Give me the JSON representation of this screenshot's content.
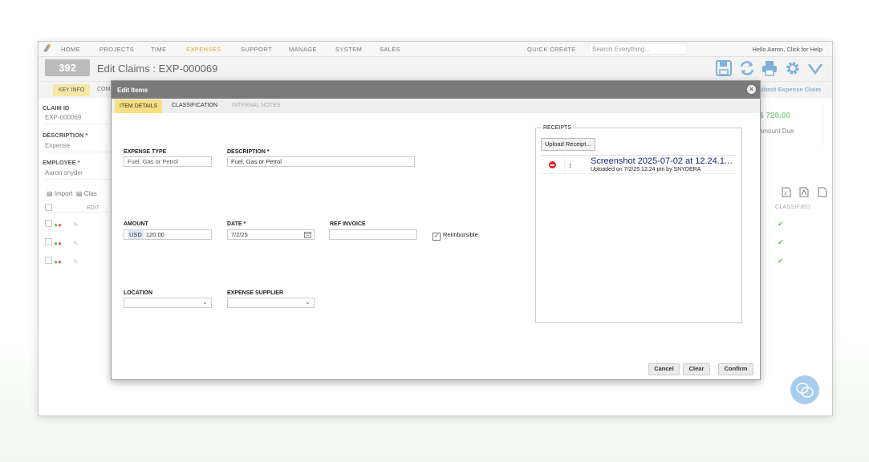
{
  "nav": {
    "items": [
      "HOME",
      "PROJECTS",
      "TIME",
      "EXPENSES",
      "SUPPORT",
      "MANAGE",
      "SYSTEM",
      "SALES"
    ],
    "active": "EXPENSES",
    "quick_create": "QUICK CREATE",
    "search_placeholder": "Search Everything...",
    "hello": "Hello Aaron, Click for Help"
  },
  "header": {
    "badge": "392",
    "title": "Edit Claims : EXP-000069",
    "submit": "Submit Expense Claim"
  },
  "subtabs": {
    "key_info": "KEY INFO",
    "comm": "COMM"
  },
  "claim": {
    "claim_id_label": "CLAIM ID",
    "claim_id": "EXP-000069",
    "description_label": "DESCRIPTION *",
    "description": "Expense",
    "employee_label": "EMPLOYEE *",
    "employee": "Aaron snyder"
  },
  "grid": {
    "import": "Import",
    "class": "Clas",
    "edit_header": "EDIT",
    "classified_header": "CLASSIFIED"
  },
  "summary": {
    "amount": "$ 720.00",
    "amount_label": "Amount Due"
  },
  "modal": {
    "title": "Edit Items",
    "tabs": [
      "ITEM DETAILS",
      "CLASSIFICATION",
      "INTERNAL NOTES"
    ],
    "expense_type_label": "EXPENSE TYPE",
    "expense_type": "Fuel, Gas or Petrol",
    "description_label": "DESCRIPTION *",
    "description": "Fuel, Gas or Petrol",
    "amount_label": "AMOUNT",
    "currency": "USD",
    "amount": "120.00",
    "date_label": "DATE *",
    "date": "7/2/25",
    "ref_invoice_label": "REF INVOICE",
    "ref_invoice": "",
    "reimbursible_label": "Reimbursible",
    "reimbursible_checked": true,
    "location_label": "LOCATION",
    "supplier_label": "EXPENSE SUPPLIER",
    "receipts_label": "RECEIPTS",
    "upload_label": "Upload Receipt...",
    "receipt_name": "Screenshot 2025-07-02 at 12.24.11 pm",
    "receipt_info": "Uploaded on 7/2/25 12:24 pm by SNYDERA",
    "cancel": "Cancel",
    "clear": "Clear",
    "confirm": "Confirm"
  },
  "colors": {
    "accent": "#f0a030",
    "tab_selected": "#f7df83",
    "amount": "#8fcf90",
    "modal_header": "#7a7a7a"
  }
}
